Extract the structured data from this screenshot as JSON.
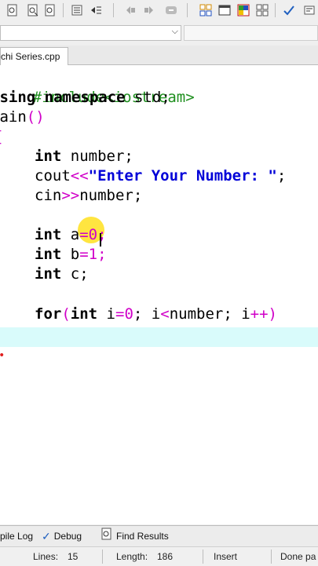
{
  "toolbar": {
    "icons": [
      "find-icon",
      "find-replace-icon",
      "indent-icon",
      "unindent-icon",
      "bookmark-back-icon",
      "bookmark-forward-icon",
      "goto-icon",
      "layout-icon",
      "window-icon",
      "panels-icon",
      "grid-icon",
      "check-icon",
      "debug-icon"
    ]
  },
  "tab": {
    "label": "chi Series.cpp"
  },
  "code": {
    "l1": "#include<iostream>",
    "l2a": "using",
    "l2b": " namespace",
    "l2c": " std;",
    "l3a": "main",
    "l3b": "()",
    "l4": "{",
    "l5a": "int",
    "l5b": " number;",
    "l6a": "cout",
    "l6b": "<<",
    "l6c": "\"Enter Your Number: \"",
    "l6d": ";",
    "l7a": "cin",
    "l7b": ">>",
    "l7c": "number;",
    "l8a": "int",
    "l8b": " a",
    "l8c": "=",
    "l8d": "0",
    "l8e": ";",
    "l9a": "int",
    "l9b": " b",
    "l9c": "=",
    "l9d": "1",
    "l9e": ";",
    "l10a": "int",
    "l10b": " c;",
    "l11a": "for",
    "l11b": "(",
    "l11c": "int",
    "l11d": " i",
    "l11e": "=",
    "l11f": "0",
    "l11g": "; i",
    "l11h": "<",
    "l11i": "number; i",
    "l11j": "++",
    "l11k": ")"
  },
  "bottom_tabs": {
    "compile_log": "pile Log",
    "debug": "Debug",
    "find_results": "Find Results"
  },
  "status": {
    "lines_label": "Lines:",
    "lines_value": "15",
    "length_label": "Length:",
    "length_value": "186",
    "mode": "Insert",
    "done": "Done pa"
  },
  "colors": {
    "preprocessor": "#1f8f1f",
    "operator": "#d000c8",
    "string": "#0000d8",
    "current_line": "#d9fbfb"
  }
}
